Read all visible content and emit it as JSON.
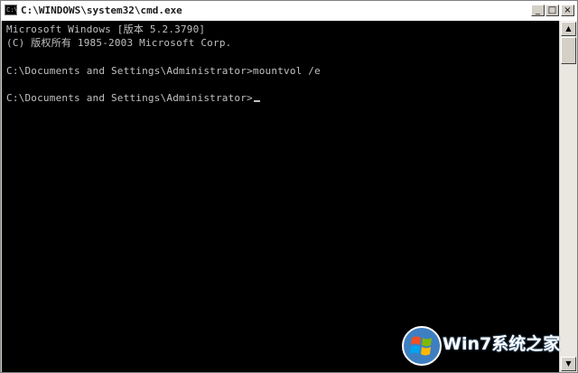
{
  "window": {
    "title": "C:\\WINDOWS\\system32\\cmd.exe",
    "buttons": {
      "minimize": "_",
      "maximize": "□",
      "close": "×"
    }
  },
  "console": {
    "lines": [
      "Microsoft Windows [版本 5.2.3790]",
      "(C) 版权所有 1985-2003 Microsoft Corp.",
      "C:\\Documents and Settings\\Administrator>mountvol /e",
      "C:\\Documents and Settings\\Administrator>"
    ],
    "text_color": "#c0c0c0",
    "background": "#000000"
  },
  "scrollbar": {
    "up": "▲",
    "down": "▼"
  },
  "watermark": {
    "text": "Win7系统之家",
    "logo": "windows-flag-logo"
  }
}
